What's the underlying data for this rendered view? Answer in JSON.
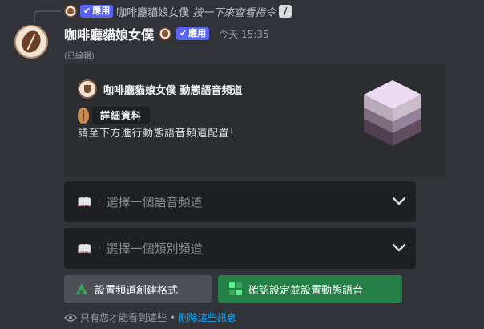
{
  "reply": {
    "app_badge": "應用",
    "name": "咖啡廳貓娘女僕",
    "command_text": "按一下來查看指令"
  },
  "message": {
    "username": "咖啡廳貓娘女僕",
    "app_badge": "應用",
    "timestamp": "今天 15:35",
    "edited": "(已編輯)"
  },
  "embed": {
    "author": "咖啡廳貓娘女僕 動態語音頻道",
    "field_name": "詳細資料",
    "description": "請至下方進行動態語音頻道配置！"
  },
  "selects": [
    {
      "placeholder": "選擇一個語音頻道",
      "separator": "·"
    },
    {
      "placeholder": "選擇一個類別頻道",
      "separator": "·"
    }
  ],
  "buttons": {
    "format": "設置頻道創建格式",
    "confirm": "確認設定並設置動態語音"
  },
  "footer": {
    "notice": "只有您才能看到這些 •",
    "dismiss": "刪除這些訊息"
  },
  "colors": {
    "background": "#323339",
    "embed": "#2b2d31",
    "select": "#1e1f22",
    "app_badge": "#5865f2",
    "secondary_button": "#4e5058",
    "success_button": "#248046",
    "link": "#00a8fc"
  },
  "icons": {
    "command": "slash-command-icon",
    "select": "open-book-icon",
    "format_button": "a-letter-icon",
    "confirm_button": "green-grid-icon",
    "footer": "eye-icon"
  }
}
